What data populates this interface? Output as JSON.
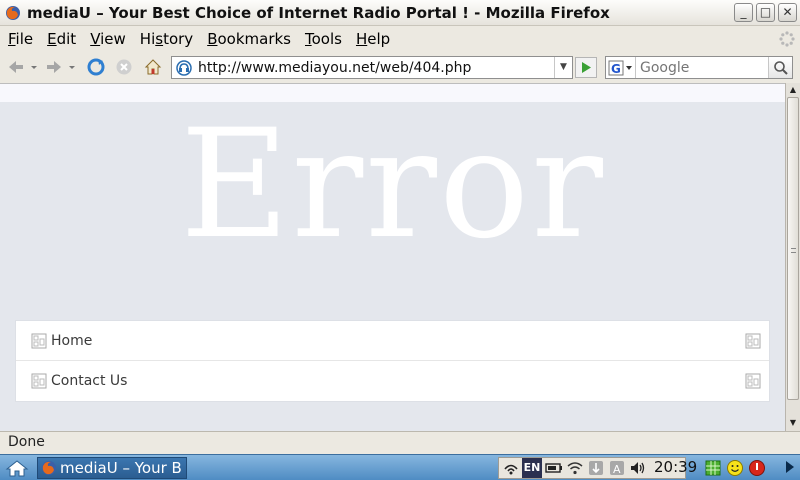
{
  "window": {
    "title": "mediaU – Your Best Choice of Internet Radio Portal ! - Mozilla Firefox",
    "minimize": "_",
    "maximize": "□",
    "close": "✕"
  },
  "menubar": {
    "items": [
      {
        "label": "File",
        "accel": "F"
      },
      {
        "label": "Edit",
        "accel": "E"
      },
      {
        "label": "View",
        "accel": "V"
      },
      {
        "label": "History",
        "accel": "s"
      },
      {
        "label": "Bookmarks",
        "accel": "B"
      },
      {
        "label": "Tools",
        "accel": "T"
      },
      {
        "label": "Help",
        "accel": "H"
      }
    ],
    "item_0": "File",
    "item_1": "Edit",
    "item_2": "View",
    "item_3": "History",
    "item_4": "Bookmarks",
    "item_5": "Tools",
    "item_6": "Help"
  },
  "toolbar": {
    "url": "http://www.mediayou.net/web/404.php",
    "search_placeholder": "Google",
    "back_icon": "back-arrow-icon",
    "forward_icon": "forward-arrow-icon",
    "reload_icon": "reload-icon",
    "stop_icon": "stop-icon",
    "home_icon": "home-icon"
  },
  "page": {
    "heading": "Error",
    "nav": [
      {
        "label": "Home"
      },
      {
        "label": "Contact Us"
      }
    ]
  },
  "status": {
    "text": "Done"
  },
  "taskbar": {
    "task_label": "mediaU – Your B",
    "keyboard_layout": "EN",
    "clock": "20:39"
  },
  "colors": {
    "content_bg": "#e4e7ed",
    "error_text": "#ffffff",
    "taskbar": "#5a96cc"
  }
}
